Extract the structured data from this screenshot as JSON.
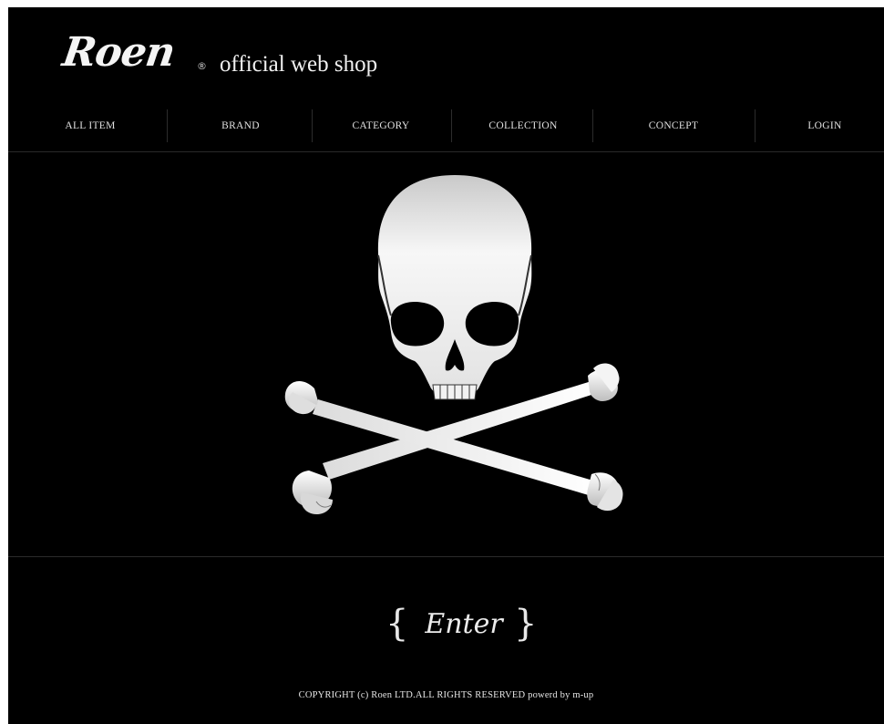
{
  "header": {
    "logo_text": "Roen",
    "logo_registered": "®",
    "shop_label": "official web shop"
  },
  "nav": {
    "items": [
      {
        "label": "ALL ITEM"
      },
      {
        "label": "BRAND"
      },
      {
        "label": "CATEGORY"
      },
      {
        "label": "COLLECTION"
      },
      {
        "label": "CONCEPT"
      },
      {
        "label": "LOGIN"
      }
    ]
  },
  "hero": {
    "icon": "skull-and-crossbones-icon"
  },
  "enter": {
    "open_brace": "{",
    "label": "Enter",
    "close_brace": "}"
  },
  "footer": {
    "copyright": "COPYRIGHT (c) Roen LTD.ALL RIGHTS RESERVED powerd by m-up"
  },
  "colors": {
    "background": "#000000",
    "text": "#ffffff",
    "divider": "#2a2a2a"
  }
}
